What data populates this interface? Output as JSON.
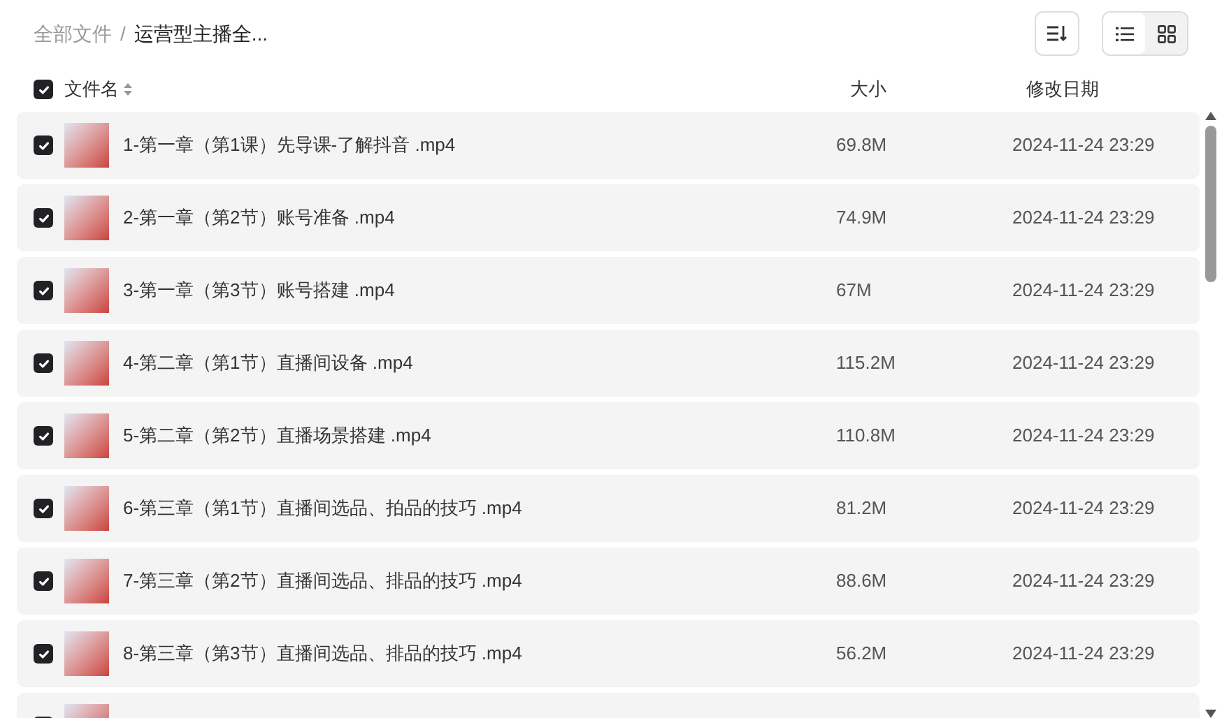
{
  "breadcrumb": {
    "root": "全部文件",
    "separator": "/",
    "current": "运营型主播全..."
  },
  "views": [
    {
      "kind": "list",
      "selected": true
    },
    {
      "kind": "grid",
      "selected": false
    }
  ],
  "header": {
    "checked": true,
    "name": "文件名",
    "size": "大小",
    "date": "修改日期"
  },
  "rows": [
    {
      "checked": true,
      "name": "1-第一章（第1课）先导课-了解抖音 .mp4",
      "size": "69.8M",
      "date": "2024-11-24 23:29"
    },
    {
      "checked": true,
      "name": "2-第一章（第2节）账号准备 .mp4",
      "size": "74.9M",
      "date": "2024-11-24 23:29"
    },
    {
      "checked": true,
      "name": "3-第一章（第3节）账号搭建 .mp4",
      "size": "67M",
      "date": "2024-11-24 23:29"
    },
    {
      "checked": true,
      "name": "4-第二章（第1节）直播间设备 .mp4",
      "size": "115.2M",
      "date": "2024-11-24 23:29"
    },
    {
      "checked": true,
      "name": "5-第二章（第2节）直播场景搭建 .mp4",
      "size": "110.8M",
      "date": "2024-11-24 23:29"
    },
    {
      "checked": true,
      "name": "6-第三章（第1节）直播间选品、拍品的技巧 .mp4",
      "size": "81.2M",
      "date": "2024-11-24 23:29"
    },
    {
      "checked": true,
      "name": "7-第三章（第2节）直播间选品、排品的技巧 .mp4",
      "size": "88.6M",
      "date": "2024-11-24 23:29"
    },
    {
      "checked": true,
      "name": "8-第三章（第3节）直播间选品、排品的技巧 .mp4",
      "size": "56.2M",
      "date": "2024-11-24 23:29"
    },
    {
      "checked": true
    }
  ]
}
